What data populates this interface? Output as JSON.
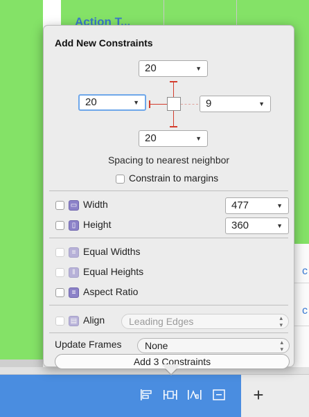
{
  "background": {
    "peek_text": "Action T..."
  },
  "popover": {
    "title": "Add New Constraints",
    "spacing": {
      "top": "20",
      "left": "20",
      "right": "9",
      "bottom": "20",
      "caption": "Spacing to nearest neighbor"
    },
    "constrain_to_margins": "Constrain to margins",
    "width": {
      "label": "Width",
      "value": "477"
    },
    "height": {
      "label": "Height",
      "value": "360"
    },
    "equal_widths": "Equal Widths",
    "equal_heights": "Equal Heights",
    "aspect_ratio": "Aspect Ratio",
    "align": {
      "label": "Align",
      "value": "Leading Edges"
    },
    "update_frames": {
      "label": "Update Frames",
      "value": "None"
    },
    "add_button": "Add 3 Constraints"
  },
  "toolbar": {
    "plus": "+"
  },
  "colors": {
    "canvas_green": "#84e267",
    "toolbar_blue": "#4a8de0",
    "strut_red": "#d33b2c",
    "icon_purple": "#8c82c8"
  }
}
